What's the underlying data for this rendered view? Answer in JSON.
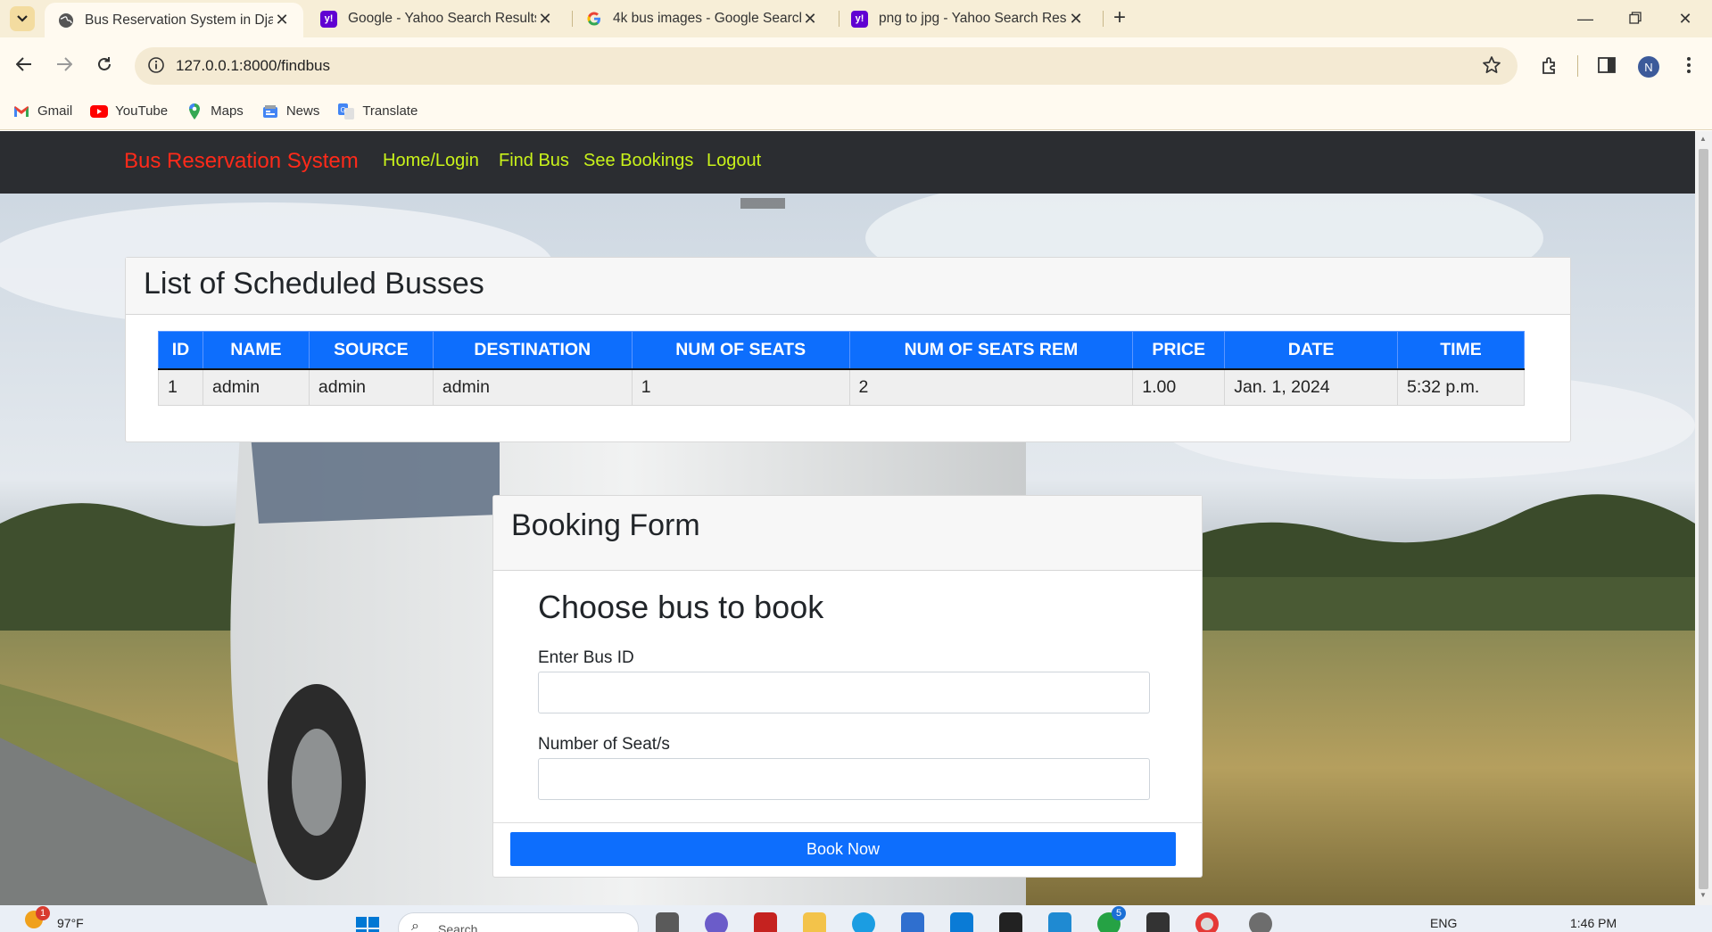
{
  "browser": {
    "tabs": [
      {
        "title": "Bus Reservation System in Djan",
        "active": true,
        "favicon": "globe-icon"
      },
      {
        "title": "Google - Yahoo Search Results",
        "active": false,
        "favicon": "yahoo-icon"
      },
      {
        "title": "4k bus images - Google Search",
        "active": false,
        "favicon": "google-icon"
      },
      {
        "title": "png to jpg - Yahoo Search Resu",
        "active": false,
        "favicon": "yahoo-icon"
      }
    ],
    "url": "127.0.0.1:8000/findbus",
    "profile_initial": "N",
    "bookmarks": [
      {
        "label": "Gmail",
        "icon": "gmail-icon"
      },
      {
        "label": "YouTube",
        "icon": "youtube-icon"
      },
      {
        "label": "Maps",
        "icon": "maps-icon"
      },
      {
        "label": "News",
        "icon": "news-icon"
      },
      {
        "label": "Translate",
        "icon": "translate-icon"
      }
    ]
  },
  "navbar": {
    "brand": "Bus Reservation System",
    "links": [
      "Home/Login",
      "Find Bus",
      "See Bookings",
      "Logout"
    ],
    "brand_color": "#ff2a1a",
    "link_color": "#c9f21a"
  },
  "schedule": {
    "title": "List of Scheduled Busses",
    "columns": [
      "ID",
      "NAME",
      "SOURCE",
      "DESTINATION",
      "NUM OF SEATS",
      "NUM OF SEATS REM",
      "PRICE",
      "DATE",
      "TIME"
    ],
    "rows": [
      [
        "1",
        "admin",
        "admin",
        "admin",
        "1",
        "2",
        "1.00",
        "Jan. 1, 2024",
        "5:32 p.m."
      ]
    ],
    "header_color": "#0d6efd"
  },
  "booking": {
    "header": "Booking Form",
    "title": "Choose bus to book",
    "bus_id_label": "Enter Bus ID",
    "bus_id_value": "",
    "seats_label": "Number of Seat/s",
    "seats_value": "",
    "submit_label": "Book Now"
  },
  "taskbar": {
    "weather": "97°F",
    "weather_badge": "1",
    "search_placeholder": "Search",
    "language": "ENG",
    "time": "1:46 PM",
    "chat_badge": "5"
  }
}
